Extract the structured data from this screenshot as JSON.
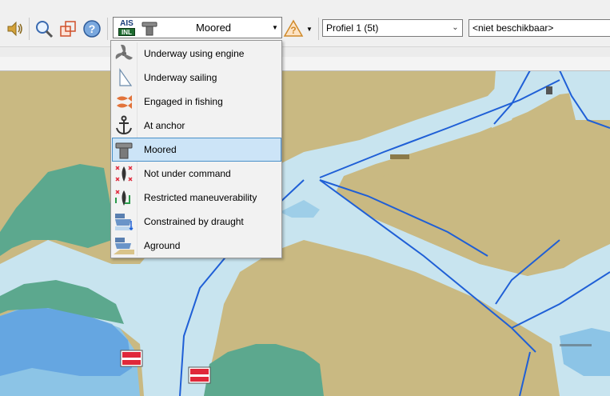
{
  "toolbar": {
    "icons": [
      "speaker-icon",
      "magnifier-icon",
      "windows-icon",
      "help-icon",
      "ais-inland-icon",
      "mooring-bollard-icon",
      "warning-triangle-icon",
      "dropdown-arrow-icon"
    ],
    "combo_value": "Moored",
    "ais_badge_top": "AIS",
    "ais_badge_bottom": "INL",
    "profile_value": "Profiel 1 (5t)",
    "unavailable_value": "<niet beschikbaar>"
  },
  "status_menu": {
    "items": [
      {
        "label": "Underway using engine",
        "icon": "propeller-icon"
      },
      {
        "label": "Underway sailing",
        "icon": "sail-icon"
      },
      {
        "label": "Engaged in fishing",
        "icon": "fish-icon"
      },
      {
        "label": "At anchor",
        "icon": "anchor-icon"
      },
      {
        "label": "Moored",
        "icon": "mooring-bollard-icon",
        "selected": true
      },
      {
        "label": "Not under command",
        "icon": "not-under-command-icon"
      },
      {
        "label": "Restricted maneuverability",
        "icon": "restricted-maneuverability-icon"
      },
      {
        "label": "Constrained by draught",
        "icon": "draught-icon"
      },
      {
        "label": "Aground",
        "icon": "aground-icon"
      }
    ]
  },
  "colors": {
    "land": "#c9b982",
    "water": "#c8e4ef",
    "shallow": "#8cc4e6",
    "marsh": "#5ca88e",
    "channel_line": "#1f5fd6",
    "menu_highlight": "#cce4f7",
    "buoy_red": "#e0283a"
  }
}
